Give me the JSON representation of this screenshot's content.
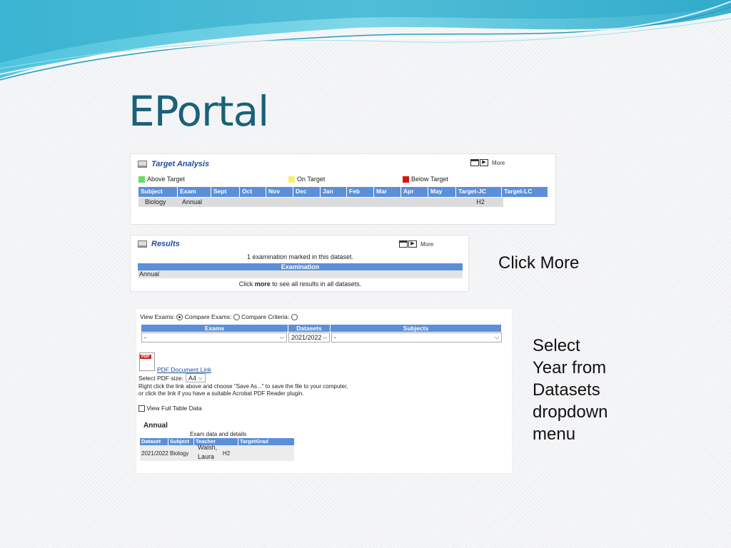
{
  "slide": {
    "title": "EPortal",
    "note_click_more": "Click More",
    "note_select": [
      "Select",
      "Year from",
      "Datasets",
      "dropdown",
      "menu"
    ]
  },
  "colors": {
    "title": "#1a6179",
    "header_blue": "#5b8fd8",
    "above_target": "#66dd66",
    "on_target": "#f4f06a",
    "below_target": "#dd1111"
  },
  "target_analysis": {
    "title": "Target Analysis",
    "more_label": "More",
    "legend": [
      {
        "label": "Above Target",
        "color": "#66dd66"
      },
      {
        "label": "On Target",
        "color": "#f4f06a"
      },
      {
        "label": "Below Target",
        "color": "#dd1111"
      }
    ],
    "columns": [
      "Subject",
      "Exam",
      "Sept",
      "Oct",
      "Nov",
      "Dec",
      "Jan",
      "Feb",
      "Mar",
      "Apr",
      "May",
      "Target-JC",
      "Target-LC"
    ],
    "row": [
      "Biology",
      "Annual",
      "",
      "",
      "",
      "",
      "",
      "",
      "",
      "",
      "",
      "H2",
      ""
    ]
  },
  "results": {
    "title": "Results",
    "more_label": "More",
    "summary": "1 examination marked in this dataset.",
    "column": "Examination",
    "row": "Annual",
    "footer_pre": "Click ",
    "footer_bold": "more",
    "footer_post": " to see all results in all datasets."
  },
  "exams_panel": {
    "view_exams_label": "View Exams:",
    "compare_exams_label": "Compare Exams:",
    "compare_criteria_label": "Compare Criteria:",
    "columns": [
      "Exams",
      "Datasets",
      "Subjects"
    ],
    "exams_value": "-",
    "datasets_value": "2021/2022",
    "subjects_value": "-",
    "pdf_icon_text": "PDF",
    "pdf_link": "PDF Document Link",
    "pdf_size_label": "Select PDF size:",
    "pdf_size_value": "A4",
    "instructions_1": "Right click the link above and choose \"Save As...\" to save the file to your computer,",
    "instructions_2": "or click the link if you have a suitable Acrobat PDF Reader plugin.",
    "full_table_label": "View Full Table Data",
    "section_title": "Annual",
    "table_caption": "Exam data and details",
    "table_columns": [
      "Dataset",
      "Subject",
      "Teacher",
      "TargetGrad"
    ],
    "table_row": {
      "dataset": "2021/2022",
      "subject": "Biology",
      "teacher_1": "Walsh,",
      "teacher_2": "Laura",
      "target": "H2"
    }
  }
}
